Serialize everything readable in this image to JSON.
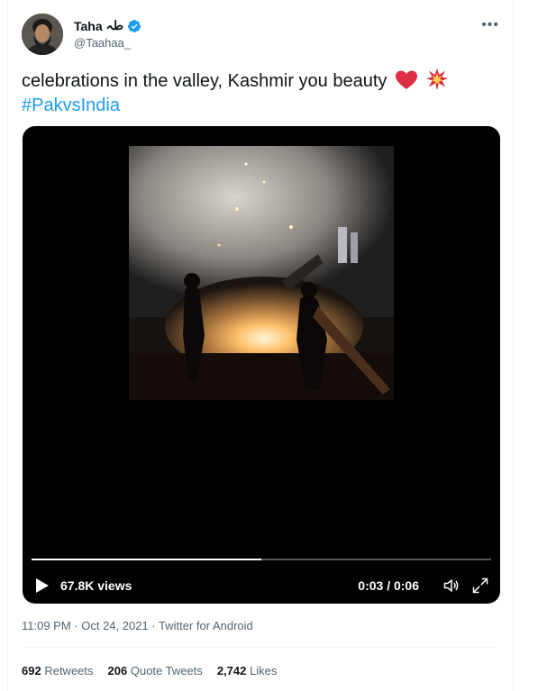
{
  "author": {
    "display_name": "Taha",
    "name_suffix": "طہ",
    "handle": "@Taahaa_",
    "avatar_icon": "avatar",
    "verified_icon": "verified-badge-icon"
  },
  "tweet": {
    "text": "celebrations in the valley, Kashmir you beauty",
    "emojis": [
      "red-heart",
      "collision"
    ],
    "hashtag": "#PakvsIndia"
  },
  "video": {
    "views": "67.8K views",
    "time": "0:03 / 0:06",
    "progress": 0.5
  },
  "meta": {
    "timestamp": "11:09 PM · Oct 24, 2021 · Twitter for Android"
  },
  "stats": {
    "retweets_count": "692",
    "retweets_label": "Retweets",
    "quotes_count": "206",
    "quotes_label": "Quote Tweets",
    "likes_count": "2,742",
    "likes_label": "Likes"
  },
  "colors": {
    "accent": "#1d9bf0",
    "text": "#0f1419",
    "secondary": "#536471"
  }
}
